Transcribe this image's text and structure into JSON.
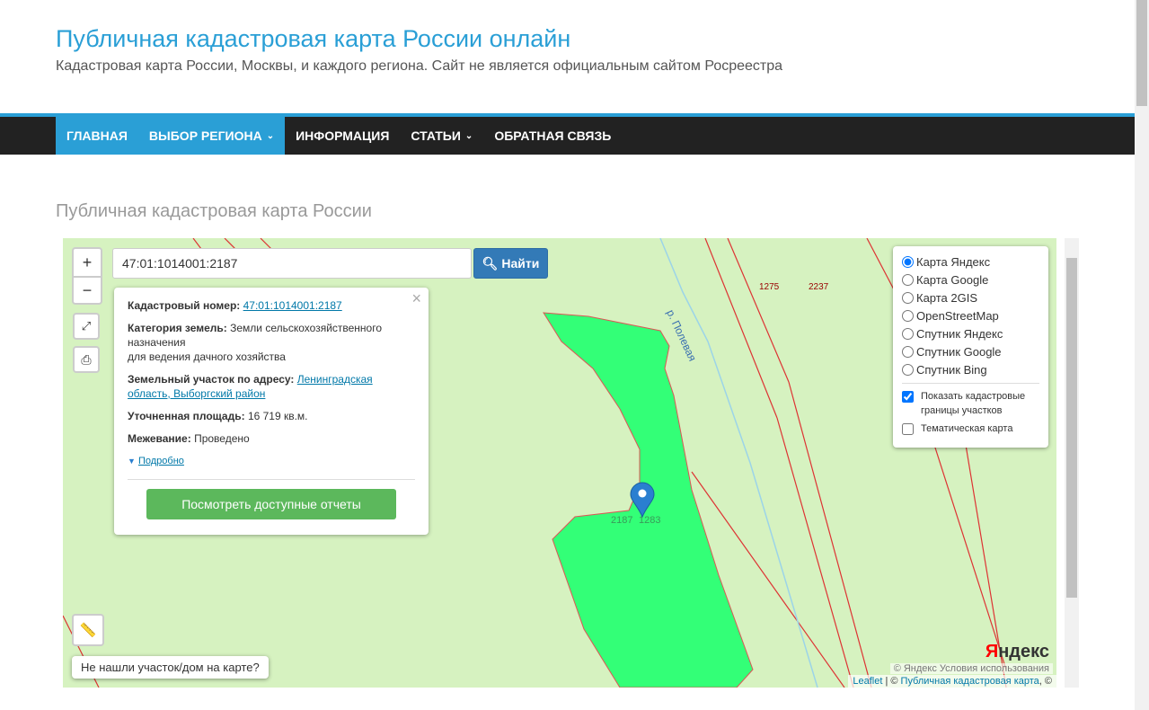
{
  "header": {
    "title": "Публичная кадастровая карта России онлайн",
    "description": "Кадастровая карта России, Москвы, и каждого региона. Сайт не является официальным сайтом Росреестра"
  },
  "nav": {
    "items": [
      {
        "label": "ГЛАВНАЯ"
      },
      {
        "label": "ВЫБОР РЕГИОНА"
      },
      {
        "label": "ИНФОРМАЦИЯ"
      },
      {
        "label": "СТАТЬИ"
      },
      {
        "label": "ОБРАТНАЯ СВЯЗЬ"
      }
    ]
  },
  "page_heading": "Публичная кадастровая карта России",
  "map": {
    "search_value": "47:01:1014001:2187",
    "find_label": "Найти",
    "zoom_in": "+",
    "zoom_out": "−",
    "popup": {
      "cad_label": "Кадастровый номер:",
      "cad_value": "47:01:1014001:2187",
      "cat_label": "Категория земель:",
      "cat_value": "Земли сельскохозяйственного назначения",
      "use_value": "для ведения дачного хозяйства",
      "addr_label": "Земельный участок по адресу:",
      "addr_value": "Ленинградская область, Выборгский район",
      "area_label": "Уточненная площадь:",
      "area_value": "16 719 кв.м.",
      "survey_label": "Межевание:",
      "survey_value": "Проведено",
      "more": "Подробно",
      "reports": "Посмотреть доступные отчеты"
    },
    "layers": {
      "options": [
        "Карта Яндекс",
        "Карта Google",
        "Карта 2GIS",
        "OpenStreetMap",
        "Спутник Яндекс",
        "Спутник Google",
        "Спутник Bing"
      ],
      "selected": "Карта Яндекс",
      "show_boundaries": "Показать кадастровые границы участков",
      "thematic": "Тематическая карта"
    },
    "labels": {
      "river": "р. Полевая",
      "p1": "1275",
      "p2": "2237",
      "p3": "2187",
      "p4": "1283"
    },
    "not_found": "Не нашли участок/дом на карте?",
    "logo": "Яндекс",
    "attribution": {
      "leaflet": "Leaflet",
      "sep": " | © ",
      "pkk": "Публичная кадастровая карта",
      "tail": ", ©",
      "yandex": "© Яндекс  Условия использования"
    },
    "colors": {
      "parcel": "#33ff77",
      "background": "#d6f2c0",
      "accent": "#2a9fd6"
    }
  }
}
